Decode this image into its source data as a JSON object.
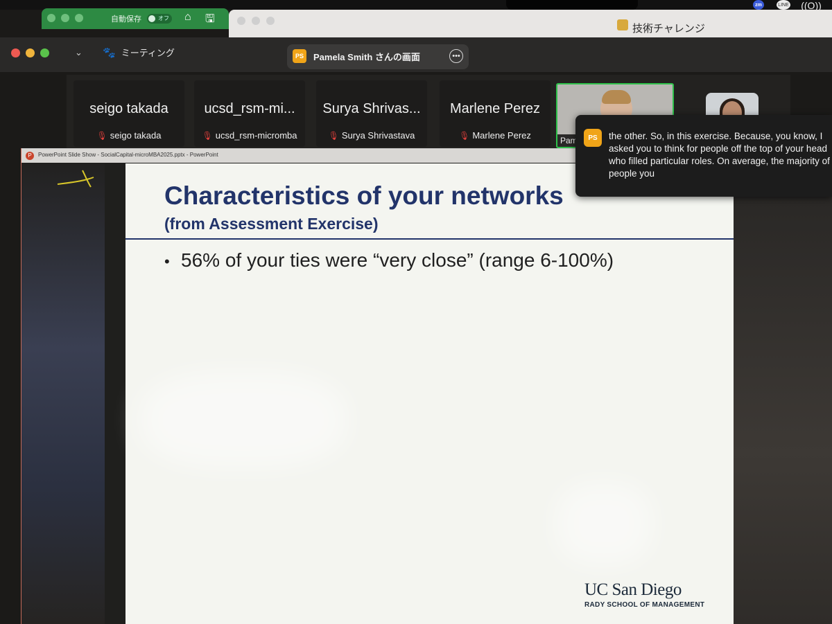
{
  "menu_bar": {
    "tray_zoom_label": "zm",
    "tray_line_label": "LINE",
    "tray_wave_icon": "((O))"
  },
  "background_app": {
    "autosave_label": "自動保存",
    "autosave_state": "オフ",
    "home_icon": "⌂",
    "save_icon": "🖫",
    "doc_title_fragment": "技術チャレンジ"
  },
  "zoom": {
    "meeting_menu_label": "ミーティング",
    "chevron": "⌄",
    "share_badge": "PS",
    "share_title": "Pamela Smith さんの画面",
    "more_glyph": "•••"
  },
  "participants": [
    {
      "big": "seigo takada",
      "small": "seigo takada"
    },
    {
      "big": "ucsd_rsm-mi...",
      "small": "ucsd_rsm-micromba"
    },
    {
      "big": "Surya Shrivas...",
      "small": "Surya Shrivastava"
    },
    {
      "big": "Marlene Perez",
      "small": "Marlene Perez"
    }
  ],
  "active_speaker": {
    "name_chip": "Pam"
  },
  "powerpoint": {
    "icon_letter": "P",
    "window_title": "PowerPoint Slide Show  -  SocialCapital-microMBA2025.pptx - PowerPoint"
  },
  "slide": {
    "title": "Characteristics of your networks",
    "subtitle": "(from Assessment Exercise)",
    "bullet_marker": "•",
    "bullet": "56% of your ties were “very close” (range 6-100%)",
    "logo_main": "UC San Diego",
    "logo_sub": "RADY SCHOOL OF MANAGEMENT"
  },
  "caption": {
    "badge": "PS",
    "text": "the other. So, in this exercise. Because, you know, I asked you to think for people off the top of your head who filled particular roles. On average, the majority of people you"
  },
  "colors": {
    "slide_title": "#22346a",
    "active_border": "#2ec14a",
    "badge": "#f0a418",
    "mic_off": "#e0403c"
  }
}
